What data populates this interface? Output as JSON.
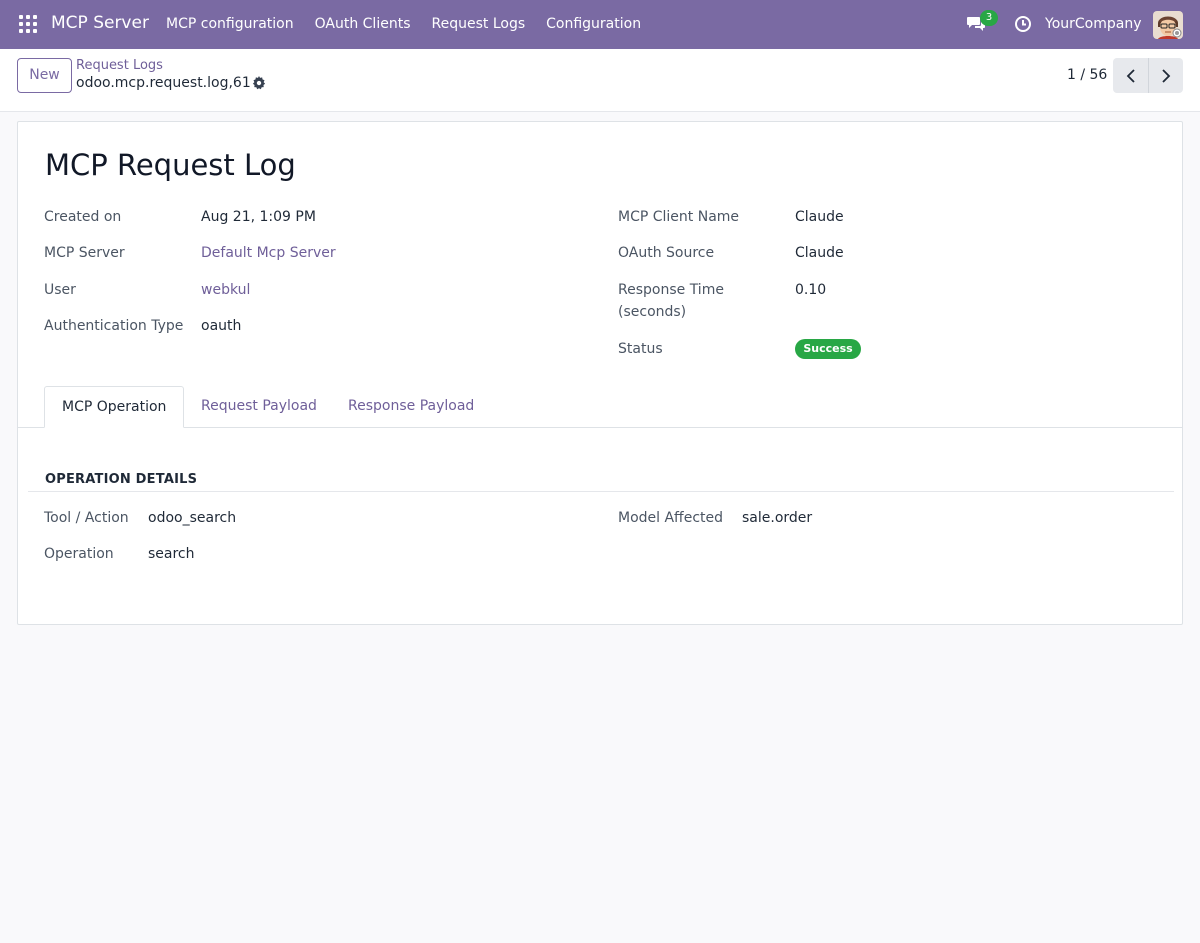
{
  "navbar": {
    "brand": "MCP Server",
    "menu": [
      "MCP configuration",
      "OAuth Clients",
      "Request Logs",
      "Configuration"
    ],
    "chat_count": "3",
    "company": "YourCompany"
  },
  "control": {
    "new_label": "New",
    "breadcrumb_parent": "Request Logs",
    "breadcrumb_current": "odoo.mcp.request.log,61",
    "pager": "1 / 56"
  },
  "form": {
    "title": "MCP Request Log",
    "left": {
      "created_on_label": "Created on",
      "created_on": "Aug 21, 1:09 PM",
      "server_label": "MCP Server",
      "server": "Default Mcp Server",
      "user_label": "User",
      "user": "webkul",
      "auth_label": "Authentication Type",
      "auth": "oauth"
    },
    "right": {
      "client_label": "MCP Client Name",
      "client": "Claude",
      "oauth_label": "OAuth Source",
      "oauth": "Claude",
      "response_label_1": "Response Time",
      "response_label_2": "(seconds)",
      "response": "0.10",
      "status_label": "Status",
      "status": "Success"
    },
    "tabs": [
      "MCP Operation",
      "Request Payload",
      "Response Payload"
    ],
    "operation": {
      "section": "OPERATION DETAILS",
      "tool_label": "Tool / Action",
      "tool": "odoo_search",
      "op_label": "Operation",
      "op": "search",
      "model_label": "Model Affected",
      "model": "sale.order"
    }
  },
  "colors": {
    "navbar": "#7a6aa3",
    "link": "#6f5f99",
    "success": "#28a745"
  }
}
